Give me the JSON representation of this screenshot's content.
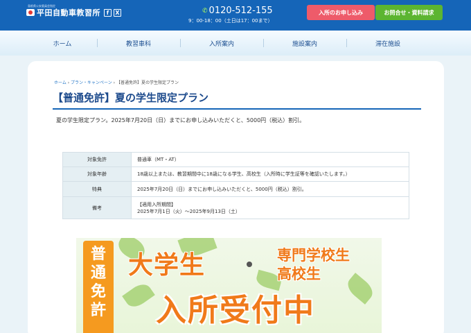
{
  "header": {
    "subtitle": "島根県公安委員会指定",
    "logo_name": "平田自動車教習所",
    "sns": [
      "f",
      "X"
    ],
    "phone_icon": "ﾌﾘｰﾀﾞｲﾔﾙ",
    "phone": "0120-512-155",
    "hours": "9：00-18：00（土日は17：00まで）",
    "apply_button": "入所のお申し込み",
    "contact_button": "お問合せ・資料請求",
    "colors": {
      "header_bg": "#1565b8",
      "apply": "#ee5b6a",
      "contact": "#5cb531"
    }
  },
  "nav": {
    "items": [
      "ホーム",
      "教習車科",
      "入所案内",
      "施設案内",
      "滞在施設"
    ]
  },
  "breadcrumb": {
    "home": "ホーム",
    "sep1": " › ",
    "plan": "プラン・キャンペーン",
    "sep2": " › ",
    "current": "【普通免許】夏の学生限定プラン"
  },
  "page": {
    "title": "【普通免許】夏の学生限定プラン",
    "summary": "夏の学生限定プラン。2025年7月20日（日）までにお申し込みいただくと、5000円（税込）割引。"
  },
  "details": [
    {
      "label": "対象免許",
      "value": "普通車（MT・AT）"
    },
    {
      "label": "対象年齢",
      "value": "18歳以上または、教習期間中に18歳になる学生、高校生（入所時に学生証等を確認いたします。）"
    },
    {
      "label": "特典",
      "value": "2025年7月20日（日）までにお申し込みいただくと、5000円（税込）割引。"
    },
    {
      "label": "備考",
      "value_line1": "【適用入所期間】",
      "value_line2": "2025年7月1日（火）〜2025年9月13日（土）"
    }
  ],
  "banner": {
    "badge": "普通免許",
    "line1": "大学生",
    "line1_dot": "・",
    "side_line1": "専門学校生",
    "side_line2": "高校生",
    "line2": "入所受付中",
    "colors": {
      "accent": "#f07a1a",
      "badge": "#f59a1f"
    }
  }
}
